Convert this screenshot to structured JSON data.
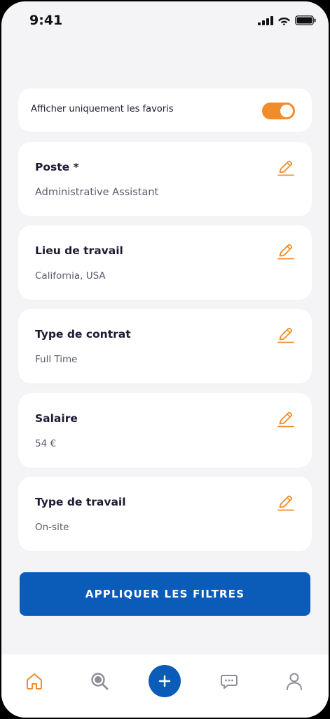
{
  "status_bar": {
    "time": "9:41"
  },
  "favorites": {
    "label": "Afficher uniquement les favoris",
    "enabled": true
  },
  "filters": [
    {
      "title": "Poste *",
      "value": "Administrative Assistant"
    },
    {
      "title": "Lieu de travail",
      "value": "California, USA"
    },
    {
      "title": "Type de contrat",
      "value": "Full Time"
    },
    {
      "title": "Salaire",
      "value": "54 €"
    },
    {
      "title": "Type de travail",
      "value": "On-site"
    }
  ],
  "apply_button": {
    "label": "APPLIQUER LES FILTRES"
  },
  "bottom_nav": {
    "items": [
      {
        "icon": "home-icon",
        "active": true
      },
      {
        "icon": "search-icon",
        "active": false
      },
      {
        "icon": "plus-icon",
        "active": false
      },
      {
        "icon": "chat-icon",
        "active": false
      },
      {
        "icon": "profile-icon",
        "active": false
      }
    ]
  },
  "colors": {
    "accent": "#f28c28",
    "primary": "#0b5cb8",
    "background": "#f4f4f6",
    "inactive_icon": "#8e8e9a"
  }
}
